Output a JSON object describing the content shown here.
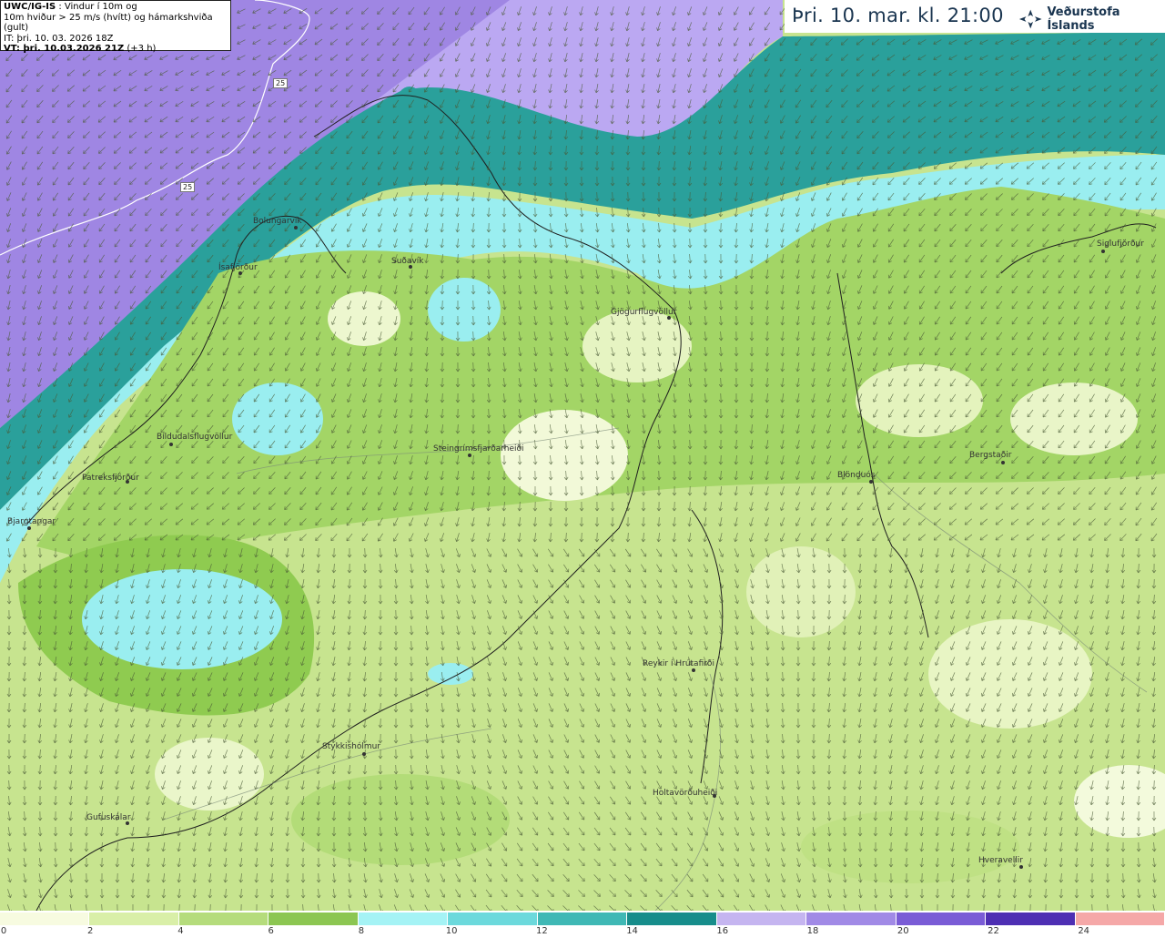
{
  "info": {
    "model": "UWC/IG-IS",
    "line1_rest": " : Vindur í 10m og",
    "line2": "10m hviður > 25 m/s (hvítt) og hámarkshviða (gult)",
    "line3": "IT: þri. 10. 03. 2026 18Z",
    "line4_bold": "VT: þri. 10.03.2026 21Z",
    "line4_rest": " (+3 h)"
  },
  "header": {
    "datetime": "Þri. 10. mar. kl. 21:00",
    "brand": "Veðurstofa Íslands",
    "brand_icon": "vedurstofa-logo-icon"
  },
  "contour_labels": [
    "25",
    "25"
  ],
  "places": [
    {
      "name": "Bolungarvík"
    },
    {
      "name": "Ísafjörður"
    },
    {
      "name": "Suðavík"
    },
    {
      "name": "Gjögurflugvöllur"
    },
    {
      "name": "Siglufjörður"
    },
    {
      "name": "Bíldudalsflugvöllur"
    },
    {
      "name": "Patreksfjörður"
    },
    {
      "name": "Bjargtangar"
    },
    {
      "name": "Steingrímsfjarðarheiði"
    },
    {
      "name": "Blönduós"
    },
    {
      "name": "Bergstaðir"
    },
    {
      "name": "Reykir í Hrútafirði"
    },
    {
      "name": "Stykkishólmur"
    },
    {
      "name": "Holtavörðuheiði"
    },
    {
      "name": "Gufuskálar"
    },
    {
      "name": "Hveravellir"
    }
  ],
  "legend": {
    "ticks": [
      "0",
      "2",
      "4",
      "6",
      "8",
      "10",
      "12",
      "14",
      "16",
      "18",
      "20",
      "22",
      "24"
    ],
    "colors": [
      "#f7fbe0",
      "#d9efa8",
      "#b5dc7c",
      "#8cc652",
      "#a5f3f5",
      "#6cd9dc",
      "#3fb8b5",
      "#178d8b",
      "#c5b5f0",
      "#a18ae6",
      "#7a5cd6",
      "#4e2fb3",
      "#f5a8a8"
    ]
  },
  "map_layers": {
    "sea_far": "#a890e8",
    "sea_violet": "#b9a6f0",
    "sea_teal": "#2aa8a2",
    "sea_cyan": "#9ff0f0",
    "land_green": "#a7d76a",
    "land_light": "#d6efa5",
    "land_pale": "#f2f9d8",
    "arrow_color": "#4a5a36"
  }
}
